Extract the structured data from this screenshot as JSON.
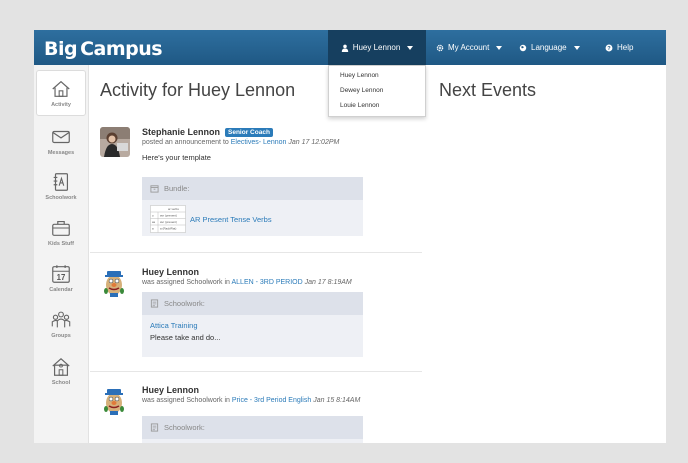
{
  "app": {
    "logo_big": "Big",
    "logo_campus": "Campus"
  },
  "topnav": {
    "user": "Huey Lennon",
    "account": "My Account",
    "language": "Language",
    "help": "Help"
  },
  "user_menu": [
    "Huey Lennon",
    "Dewey Lennon",
    "Louie Lennon"
  ],
  "sidebar": {
    "items": [
      {
        "label": "Activity",
        "icon": "home-icon"
      },
      {
        "label": "Messages",
        "icon": "envelope-icon"
      },
      {
        "label": "Schoolwork",
        "icon": "document-icon"
      },
      {
        "label": "Kids Stuff",
        "icon": "briefcase-icon"
      },
      {
        "label": "Calendar",
        "icon": "calendar-icon",
        "day": "17"
      },
      {
        "label": "Groups",
        "icon": "groups-icon"
      },
      {
        "label": "School",
        "icon": "school-icon"
      }
    ]
  },
  "main": {
    "title": "Activity for Huey Lennon",
    "events_title": "Next Events"
  },
  "activities": [
    {
      "name": "Stephanie Lennon",
      "badge": "Senior Coach",
      "action": "posted an announcement to",
      "target": "Electives- Lennon",
      "time": "Jan 17 12:02PM",
      "text": "Here's your template",
      "card_type": "Bundle:",
      "card_link": "AR Present Tense Verbs",
      "thumb_rows": [
        "ar verbs",
        "avr (present)",
        "avr (present)",
        "a (Radt/Rat)"
      ],
      "thumb_left": [
        "",
        "o",
        "as",
        "a"
      ]
    },
    {
      "name": "Huey Lennon",
      "action": "was assigned Schoolwork in",
      "target": "ALLEN - 3RD PERIOD",
      "time": "Jan 17 8:19AM",
      "card_type": "Schoolwork:",
      "card_link": "Attica Training",
      "card_desc": "Please take and do..."
    },
    {
      "name": "Huey Lennon",
      "action": "was assigned Schoolwork in",
      "target": "Price - 3rd Period English",
      "time": "Jan 15 8:14AM",
      "card_type": "Schoolwork:"
    }
  ],
  "colors": {
    "topbar": "#2a6797",
    "link": "#2b7bb9",
    "badge": "#2b7bb9",
    "card_head": "#dde1ea",
    "card_body": "#eef0f5"
  }
}
